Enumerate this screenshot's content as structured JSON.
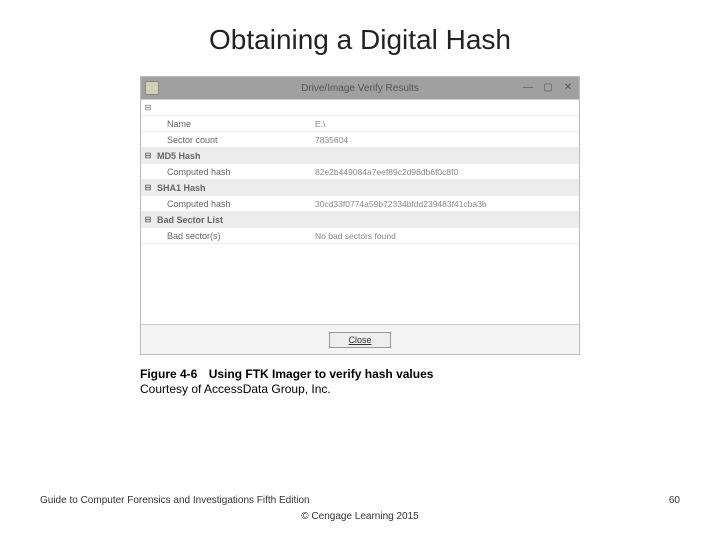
{
  "slide": {
    "title": "Obtaining a Digital Hash"
  },
  "window": {
    "title": "Drive/Image Verify Results",
    "rows": {
      "root_expander": "⊟",
      "name_label": "Name",
      "name_value": "E:\\",
      "sector_label": "Sector count",
      "sector_value": "7835604",
      "md5_expander": "⊟",
      "md5_header": "MD5 Hash",
      "md5_computed_label": "Computed hash",
      "md5_computed_value": "82e2b449084a7eef89c2d98db6f0c8f0",
      "sha1_expander": "⊟",
      "sha1_header": "SHA1 Hash",
      "sha1_computed_label": "Computed hash",
      "sha1_computed_value": "30cd33f0774a59b72334bfdd239483f41cba3b",
      "bad_expander": "⊟",
      "bad_header": "Bad Sector List",
      "bad_label": "Bad sector(s)",
      "bad_value": "No bad sectors found"
    },
    "close_button": "Close"
  },
  "caption": {
    "fig_label": "Figure 4-6",
    "fig_text": "Using FTK Imager to verify hash values",
    "courtesy": "Courtesy of AccessData Group, Inc."
  },
  "footer": {
    "left": "Guide to Computer Forensics and Investigations Fifth Edition",
    "center": "© Cengage Learning 2015",
    "right": "60"
  }
}
